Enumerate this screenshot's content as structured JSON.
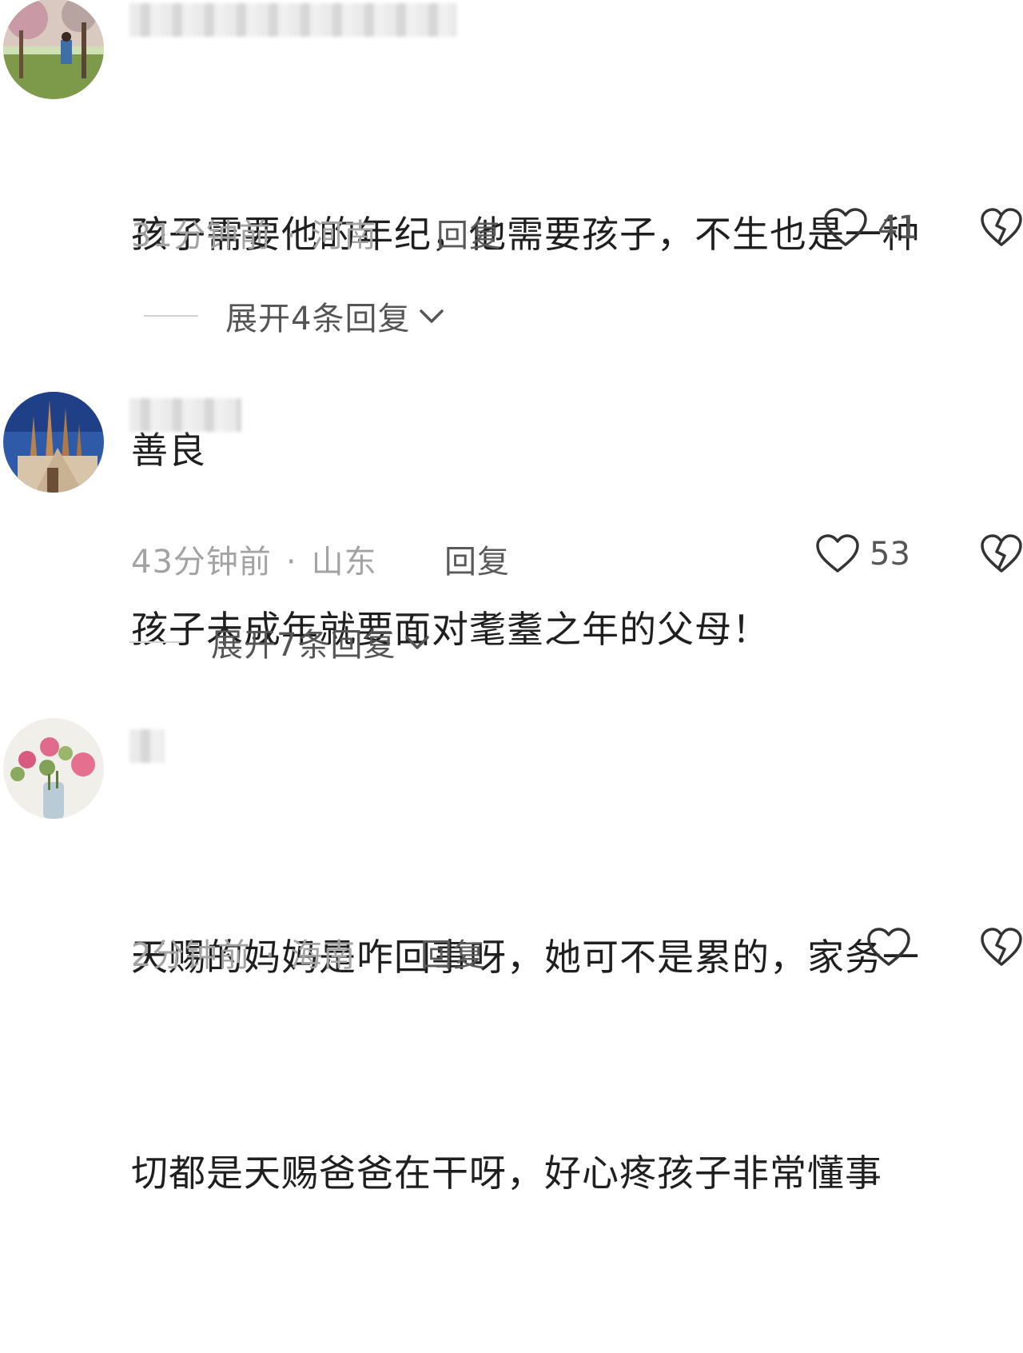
{
  "comments": [
    {
      "text_lines": [
        "孩子需要他的年纪，他需要孩子，不生也是一种",
        "善良"
      ],
      "time": "31分钟前",
      "location": "河南",
      "reply_label": "回复",
      "likes": "41",
      "expand_label": "展开4条回复"
    },
    {
      "text_lines": [
        "孩子未成年就要面对耄耋之年的父母！"
      ],
      "time": "43分钟前",
      "location": "山东",
      "reply_label": "回复",
      "likes": "53",
      "expand_label": "展开7条回复"
    },
    {
      "text_lines": [
        "天赐的妈妈是咋回事呀，她可不是累的，家务一",
        "切都是天赐爸爸在干呀，好心疼孩子非常懂事"
      ],
      "time": "2分钟前",
      "location": "海南",
      "reply_label": "回复",
      "likes": ""
    }
  ],
  "separator": "·",
  "icons": {
    "like": "heart-outline-icon",
    "dislike": "broken-heart-icon",
    "expand": "chevron-down-icon"
  }
}
